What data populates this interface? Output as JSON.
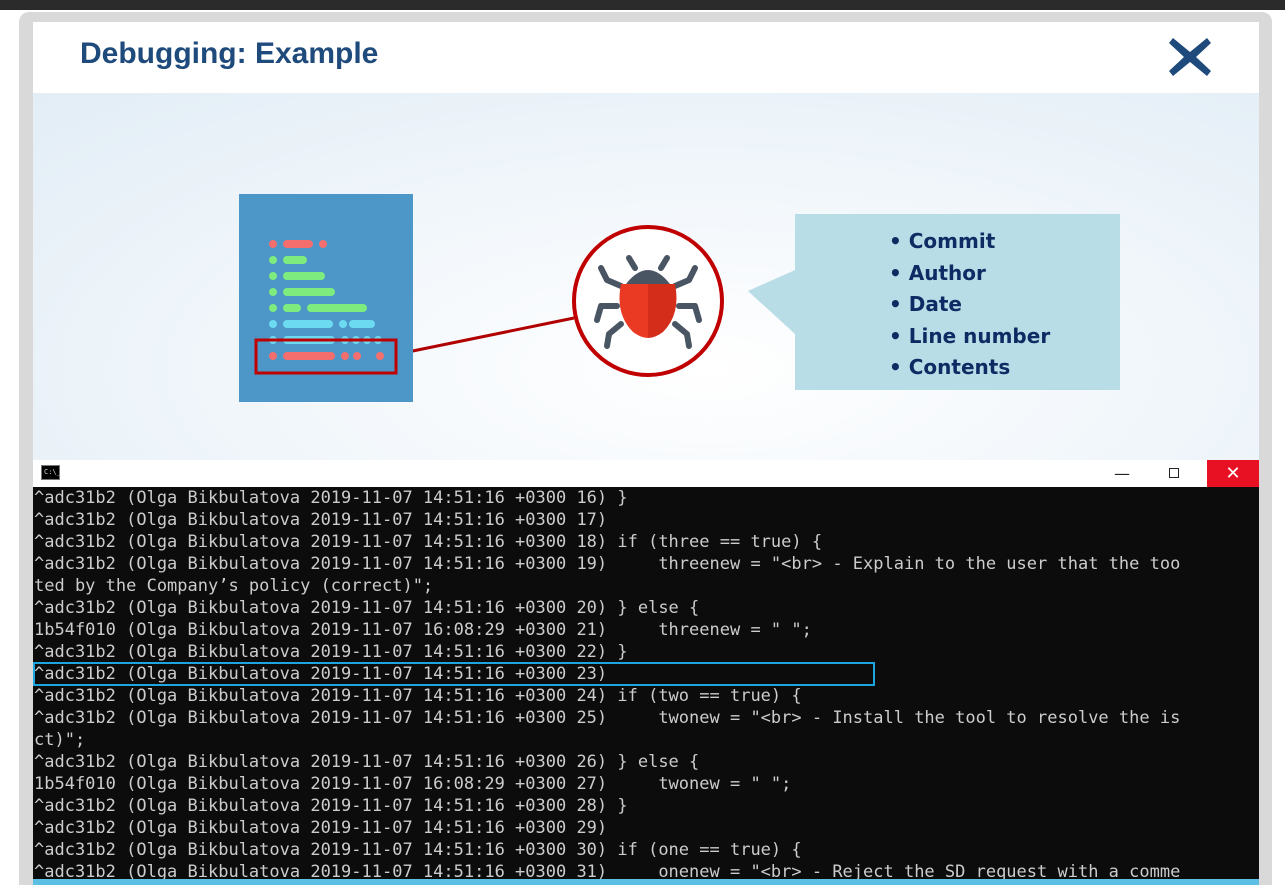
{
  "slide": {
    "title": "Debugging: Example",
    "close_icon": "close-x-icon",
    "callout_items": [
      "Commit",
      "Author",
      "Date",
      "Line number",
      "Contents"
    ],
    "colors": {
      "title": "#1f4a7c",
      "doc_bg": "#4d97c8",
      "highlight_red": "#c00000",
      "callout_bg": "#b8dde6",
      "bug_red": "#ea3a23"
    }
  },
  "console": {
    "icon_label": "C:\\_",
    "min_glyph": "—",
    "close_glyph": "✕",
    "lines": [
      "^adc31b2 (Olga Bikbulatova 2019-11-07 14:51:16 +0300 16) }",
      "^adc31b2 (Olga Bikbulatova 2019-11-07 14:51:16 +0300 17)",
      "^adc31b2 (Olga Bikbulatova 2019-11-07 14:51:16 +0300 18) if (three == true) {",
      "^adc31b2 (Olga Bikbulatova 2019-11-07 14:51:16 +0300 19)     threenew = \"<br> - Explain to the user that the too",
      "ted by the Company’s policy (correct)\";",
      "^adc31b2 (Olga Bikbulatova 2019-11-07 14:51:16 +0300 20) } else {",
      "1b54f010 (Olga Bikbulatova 2019-11-07 16:08:29 +0300 21)     threenew = \" \";",
      "^adc31b2 (Olga Bikbulatova 2019-11-07 14:51:16 +0300 22) }",
      "^adc31b2 (Olga Bikbulatova 2019-11-07 14:51:16 +0300 23)",
      "^adc31b2 (Olga Bikbulatova 2019-11-07 14:51:16 +0300 24) if (two == true) {",
      "^adc31b2 (Olga Bikbulatova 2019-11-07 14:51:16 +0300 25)     twonew = \"<br> - Install the tool to resolve the is",
      "ct)\";",
      "^adc31b2 (Olga Bikbulatova 2019-11-07 14:51:16 +0300 26) } else {",
      "1b54f010 (Olga Bikbulatova 2019-11-07 16:08:29 +0300 27)     twonew = \" \";",
      "^adc31b2 (Olga Bikbulatova 2019-11-07 14:51:16 +0300 28) }",
      "^adc31b2 (Olga Bikbulatova 2019-11-07 14:51:16 +0300 29)",
      "^adc31b2 (Olga Bikbulatova 2019-11-07 14:51:16 +0300 30) if (one == true) {",
      "^adc31b2 (Olga Bikbulatova 2019-11-07 14:51:16 +0300 31)     onenew = \"<br> - Reject the SD request with a comme"
    ],
    "highlighted_line": 8
  }
}
